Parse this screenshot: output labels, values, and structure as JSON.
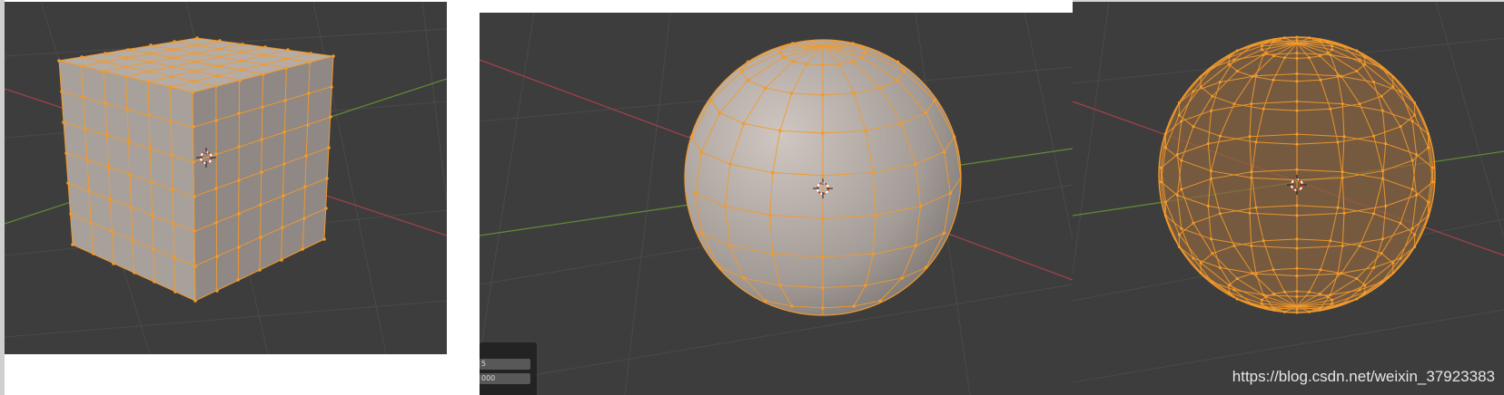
{
  "viewports": [
    {
      "name": "cube-viewport",
      "mesh": "subdivided-cube",
      "mode": "edit-vertex"
    },
    {
      "name": "sphere-viewport",
      "mesh": "uv-sphere",
      "mode": "edit-vertex"
    },
    {
      "name": "wireframe-sphere-viewport",
      "mesh": "uv-sphere",
      "mode": "wireframe"
    }
  ],
  "operator_panel": {
    "field_1": "5",
    "field_2": "000"
  },
  "watermark": "https://blog.csdn.net/weixin_37923383",
  "colors": {
    "viewport_bg": "#3d3d3d",
    "grid": "#4a4a4a",
    "x_axis": "#a0404a",
    "y_axis": "#5f8a33",
    "mesh_face": "#a8a09b",
    "selection": "#f39a2a",
    "wire_fill": "#8a6440"
  },
  "icons": [
    "3d-cursor-icon"
  ]
}
